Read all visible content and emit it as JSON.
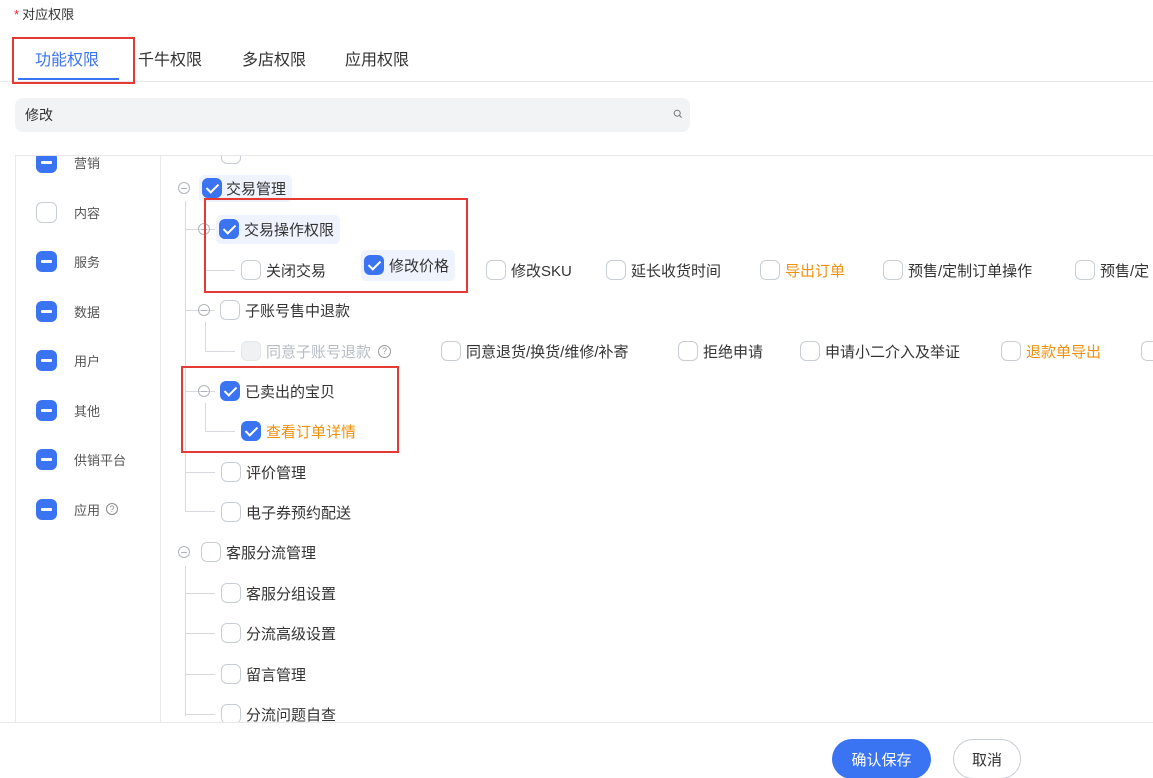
{
  "section": {
    "required_mark": "*",
    "label": "对应权限"
  },
  "tabs": [
    {
      "label": "功能权限",
      "active": true
    },
    {
      "label": "千牛权限",
      "active": false
    },
    {
      "label": "多店权限",
      "active": false
    },
    {
      "label": "应用权限",
      "active": false
    }
  ],
  "search": {
    "value": "修改",
    "icon": "search-icon"
  },
  "categories": [
    {
      "label": "营销",
      "state": "indeterminate"
    },
    {
      "label": "内容",
      "state": "unchecked"
    },
    {
      "label": "服务",
      "state": "indeterminate"
    },
    {
      "label": "数据",
      "state": "indeterminate"
    },
    {
      "label": "用户",
      "state": "indeterminate"
    },
    {
      "label": "其他",
      "state": "indeterminate"
    },
    {
      "label": "供销平台",
      "state": "indeterminate"
    },
    {
      "label": "应用",
      "state": "indeterminate",
      "help": "?"
    }
  ],
  "tree": {
    "trade_mgmt": {
      "label": "交易管理",
      "checked": true
    },
    "trade_ops": {
      "label": "交易操作权限",
      "checked": true,
      "items": [
        {
          "label": "关闭交易",
          "checked": false
        },
        {
          "label": "修改价格",
          "checked": true
        },
        {
          "label": "修改SKU",
          "checked": false
        },
        {
          "label": "延长收货时间",
          "checked": false
        },
        {
          "label": "导出订单",
          "checked": false,
          "highlight": true
        },
        {
          "label": "预售/定制订单操作",
          "checked": false
        },
        {
          "label": "预售/定",
          "checked": false
        }
      ]
    },
    "sub_refund": {
      "label": "子账号售中退款",
      "checked": false,
      "items": [
        {
          "label": "同意子账号退款",
          "disabled": true,
          "help": "?"
        },
        {
          "label": "同意退货/换货/维修/补寄",
          "checked": false
        },
        {
          "label": "拒绝申请",
          "checked": false
        },
        {
          "label": "申请小二介入及举证",
          "checked": false
        },
        {
          "label": "退款单导出",
          "checked": false,
          "highlight": true
        }
      ]
    },
    "sold_items": {
      "label": "已卖出的宝贝",
      "checked": true,
      "items": [
        {
          "label": "查看订单详情",
          "checked": true,
          "highlight": true
        }
      ]
    },
    "review_mgmt": {
      "label": "评价管理",
      "checked": false
    },
    "ecoupon": {
      "label": "电子券预约配送",
      "checked": false
    },
    "cs_routing": {
      "label": "客服分流管理",
      "checked": false,
      "items": [
        {
          "label": "客服分组设置",
          "checked": false
        },
        {
          "label": "分流高级设置",
          "checked": false
        },
        {
          "label": "留言管理",
          "checked": false
        },
        {
          "label": "分流问题自查",
          "checked": false
        }
      ]
    }
  },
  "footer": {
    "confirm_label": "确认保存",
    "cancel_label": "取消"
  },
  "colors": {
    "primary": "#3b74f2",
    "highlight_text": "#f0900b",
    "annotation_box": "#e53935"
  }
}
